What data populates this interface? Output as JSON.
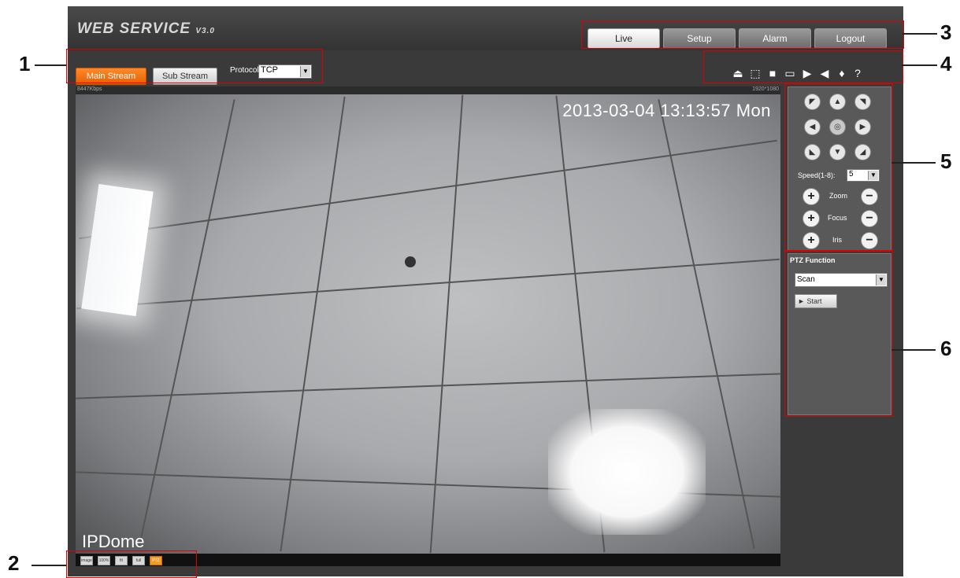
{
  "header": {
    "logo": "WEB  SERVICE",
    "logo_version": "V3.0",
    "tabs": [
      {
        "label": "Live",
        "active": true
      },
      {
        "label": "Setup",
        "active": false
      },
      {
        "label": "Alarm",
        "active": false
      },
      {
        "label": "Logout",
        "active": false
      }
    ]
  },
  "stream": {
    "main_label": "Main Stream",
    "sub_label": "Sub Stream",
    "protocol_label": "Protocol",
    "protocol_value": "TCP"
  },
  "video": {
    "bitrate": "8447Kbps",
    "resolution": "1920*1080",
    "timestamp": "2013-03-04 13:13:57 Mon",
    "channel_name": "IPDome"
  },
  "bottom_toolbar": {
    "items": [
      "image",
      "100%",
      "fit",
      "full",
      "PTZ"
    ]
  },
  "ptz": {
    "speed_label": "Speed(1-8):",
    "speed_value": "5",
    "zoom_label": "Zoom",
    "focus_label": "Focus",
    "iris_label": "Iris"
  },
  "ptz_function": {
    "title": "PTZ Function",
    "mode_value": "Scan",
    "start_label": "Start"
  },
  "callouts": [
    "1",
    "2",
    "3",
    "4",
    "5",
    "6"
  ],
  "colors": {
    "accent": "#f57f17",
    "callout_border": "#dd0000",
    "panel_bg": "#3a3a3a"
  }
}
